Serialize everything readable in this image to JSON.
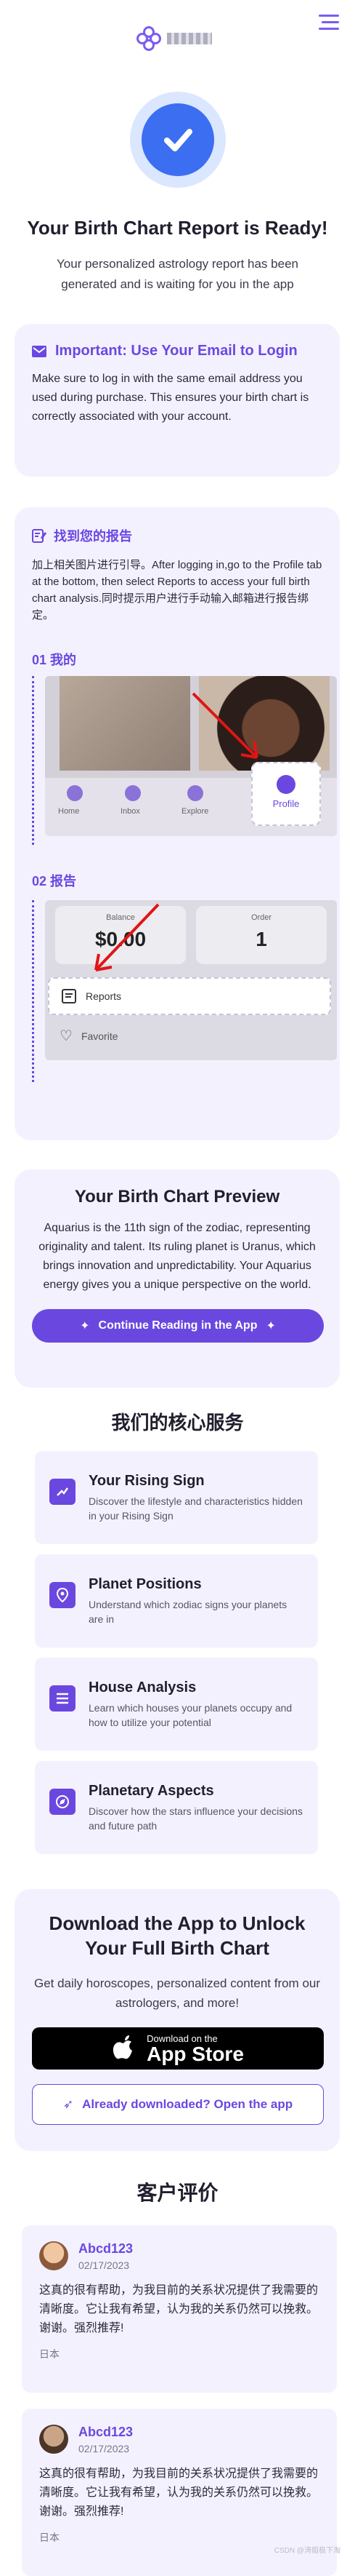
{
  "header": {
    "logo_icon": "brand-logo-icon",
    "menu_icon": "hamburger-menu-icon"
  },
  "hero": {
    "title": "Your Birth Chart Report is Ready!",
    "subtitle": "Your personalized astrology report has been generated and is waiting for you in the app"
  },
  "important": {
    "title": "Important: Use Your Email to Login",
    "body": "Make sure to log in with the same email address you used during purchase. This ensures your birth chart is correctly associated with your account."
  },
  "guide": {
    "title": "找到您的报告",
    "desc": "加上相关图片进行引导。After logging in,go to the Profile tab at the bottom, then select Reports to access your full birth chart analysis.同时提示用户进行手动输入邮箱进行报告绑定。",
    "step1_label": "01 我的",
    "step2_label": "02 报告",
    "shot1": {
      "tabs": [
        "Home",
        "Inbox",
        "Explore"
      ],
      "profile_label": "Profile"
    },
    "shot2": {
      "balance_label": "Balance",
      "balance_value": "$0.00",
      "order_label": "Order",
      "order_value": "1",
      "reports_label": "Reports",
      "favorite_label": "Favorite"
    }
  },
  "preview": {
    "title": "Your Birth Chart Preview",
    "body": "Aquarius is the 11th sign of the zodiac, representing originality and talent. Its ruling planet is Uranus, which brings innovation and unpredictability. Your Aquarius energy gives you a unique perspective on the world.",
    "button": "Continue Reading in the App"
  },
  "services": {
    "title": "我们的核心服务",
    "items": [
      {
        "title": "Your Rising Sign",
        "desc": "Discover the lifestyle and characteristics hidden in your Rising Sign",
        "icon": "trending-up-icon"
      },
      {
        "title": "Planet Positions",
        "desc": "Understand which zodiac signs your planets are in",
        "icon": "location-pin-icon"
      },
      {
        "title": "House Analysis",
        "desc": "Learn which houses your planets occupy and how to utilize your potential",
        "icon": "list-icon"
      },
      {
        "title": "Planetary Aspects",
        "desc": "Discover how the stars influence your decisions and future path",
        "icon": "compass-icon"
      }
    ]
  },
  "download": {
    "title": "Download the App to Unlock Your Full Birth Chart",
    "body": "Get daily horoscopes, personalized content from our astrologers, and more!",
    "appstore_small": "Download on the",
    "appstore_big": "App Store",
    "already": "Already downloaded? Open the app"
  },
  "reviews": {
    "title": "客户评价",
    "items": [
      {
        "name": "Abcd123",
        "date": "02/17/2023",
        "text": "这真的很有帮助，为我目前的关系状况提供了我需要的清晰度。它让我有希望，认为我的关系仍然可以挽救。谢谢。强烈推荐!",
        "country": "日本"
      },
      {
        "name": "Abcd123",
        "date": "02/17/2023",
        "text": "这真的很有帮助，为我目前的关系状况提供了我需要的清晰度。它让我有希望，认为我的关系仍然可以挽救。谢谢。强烈推荐!",
        "country": "日本"
      }
    ]
  },
  "watermark": "CSDN @涛姐极下淘",
  "colors": {
    "accent": "#6a48e0",
    "hero_blue": "#3b6ef0",
    "card_bg": "#f4f1ff"
  }
}
